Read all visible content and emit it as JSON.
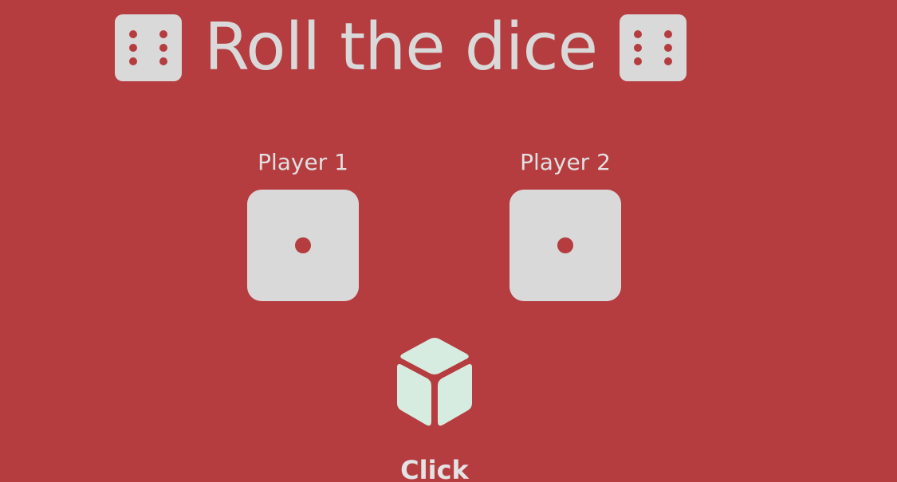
{
  "header": {
    "title": "Roll the dice",
    "left_icon": "dice-six-icon",
    "right_icon": "dice-six-icon"
  },
  "players": [
    {
      "label": "Player 1",
      "die_value": 1
    },
    {
      "label": "Player 2",
      "die_value": 1
    }
  ],
  "roll": {
    "icon": "cube-icon",
    "label": "Click"
  },
  "colors": {
    "background": "#b53c3f",
    "die": "#d9d9d9",
    "pip": "#b53c3f",
    "cube": "#d6ece0"
  }
}
